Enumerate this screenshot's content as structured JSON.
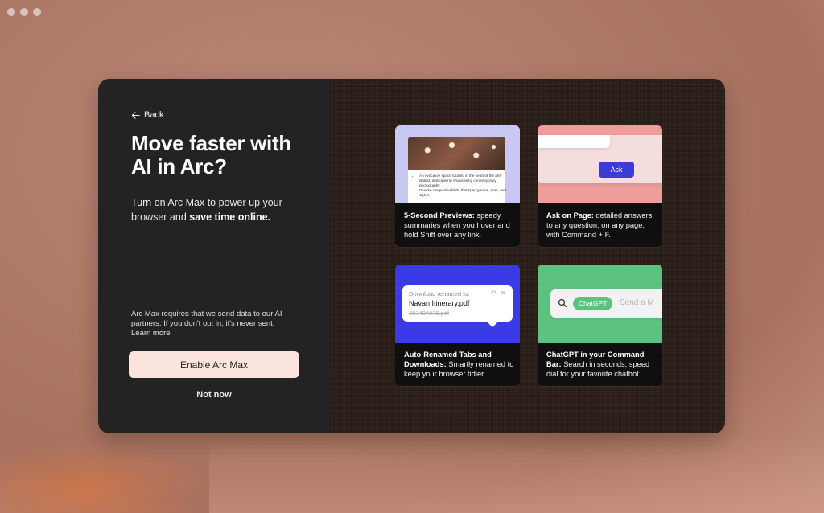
{
  "onboarding": {
    "back_label": "Back",
    "headline": "Move faster with AI in Arc?",
    "subtext_plain": "Turn on Arc Max to power up your browser and ",
    "subtext_bold": "save time online.",
    "disclaimer": "Arc Max requires that we send data to our AI partners. If you don't opt in, it's never sent.",
    "learn_more": "Learn more",
    "enable_button": "Enable Arc Max",
    "not_now": "Not now"
  },
  "features": [
    {
      "title": "5-Second Previews:",
      "body": " speedy summaries when you hover and hold Shift over any link.",
      "preview_bullets": [
        "An evocative space located in the heart of the arts district, dedicated to showcasing contemporary photography.",
        "Diverse range of exhibits that span genres, eras, and styles."
      ]
    },
    {
      "title": "Ask on Page:",
      "body": " detailed answers to any question, on any page, with Command + F.",
      "ask_button": "Ask"
    },
    {
      "title": "Auto-Renamed Tabs and Downloads:",
      "body": " Smartly renamed to keep your browser tidier.",
      "toast_label": "Download renamed to:",
      "new_name": "Navan Itinerary.pdf",
      "old_name": "387494876.pdf"
    },
    {
      "title": "ChatGPT in your Command Bar:",
      "body": " Search in seconds, speed dial for your favorite chatbot.",
      "chip_label": "ChatGPT",
      "placeholder": "Send a M"
    }
  ],
  "colors": {
    "accent_button": "#fbe4de",
    "left_panel": "#232323",
    "card_previews": "#c9c8f2",
    "card_ask": "#ee9d9a",
    "card_rename": "#3a3ae6",
    "card_chatgpt": "#5cc27f"
  }
}
